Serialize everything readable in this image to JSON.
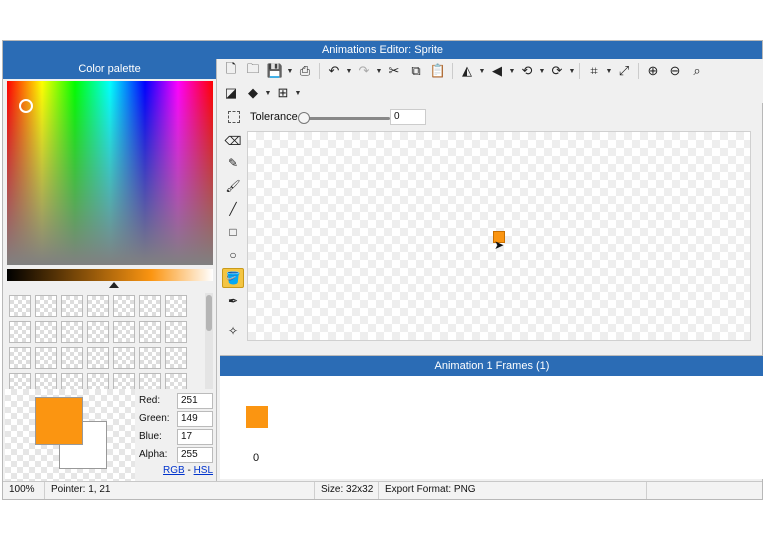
{
  "window": {
    "title": "Animations Editor: Sprite"
  },
  "palette": {
    "header": "Color palette",
    "foreground_color": "#fb9511",
    "background_color": "#ffffff",
    "channels": [
      {
        "label": "Red:",
        "value": "251"
      },
      {
        "label": "Green:",
        "value": "149"
      },
      {
        "label": "Blue:",
        "value": "17"
      },
      {
        "label": "Alpha:",
        "value": "255"
      }
    ],
    "modes": {
      "rgb": "RGB",
      "separator": "-",
      "hsl": "HSL"
    }
  },
  "toolbar": {
    "row1": [
      "new-file-icon",
      "open-folder-icon",
      "save-icon",
      "export-icon",
      "undo-icon",
      "redo-icon",
      "cut-icon",
      "copy-icon",
      "paste-icon",
      "flip-horizontal-icon",
      "flip-vertical-icon",
      "rotate-left-icon",
      "rotate-right-icon",
      "crop-icon",
      "resize-icon",
      "zoom-in-icon",
      "zoom-out-icon",
      "zoom-fit-icon"
    ],
    "row2": [
      "invert-colors-icon",
      "layers-icon",
      "grid-icon"
    ]
  },
  "tolerance": {
    "label": "Tolerance",
    "value": "0",
    "level_percent": 0
  },
  "tools": [
    "eraser-icon",
    "pencil-icon",
    "brush-icon",
    "line-icon",
    "rectangle-icon",
    "ellipse-icon",
    "fill-bucket-icon",
    "eyedropper-icon",
    "magic-wand-icon"
  ],
  "active_tool": "fill-bucket-icon",
  "sprite_color": "#fb9511",
  "animation": {
    "header": "Animation 1 Frames (1)",
    "frames": [
      {
        "label": "0",
        "color": "#fb9511"
      }
    ]
  },
  "status": {
    "zoom": "100%",
    "pointer": "Pointer: 1, 21",
    "size": "Size: 32x32",
    "format": "Export Format: PNG"
  }
}
